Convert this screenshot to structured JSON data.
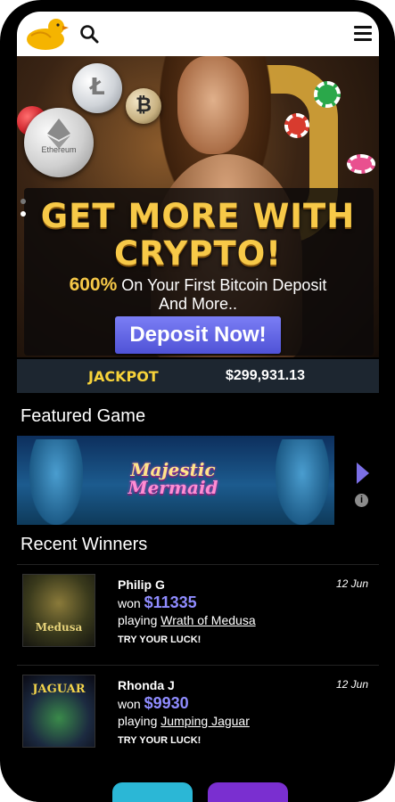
{
  "header": {
    "logo_icon": "duck-logo-icon",
    "search_icon": "search-icon",
    "menu_icon": "hamburger-menu-icon"
  },
  "hero": {
    "coin_label": "Ethereum",
    "headline_line1": "GET MORE WITH",
    "headline_line2": "CRYPTO!",
    "percent": "600%",
    "subline_rest": " On Your First Bitcoin Deposit",
    "subline2": "And More..",
    "cta_label": "Deposit Now!"
  },
  "jackpot": {
    "label": "JACKPOT",
    "value": "$299,931.13"
  },
  "featured": {
    "title": "Featured Game",
    "game_line1": "Majestic",
    "game_line2": "Mermaid"
  },
  "recent": {
    "title": "Recent Winners",
    "winners": [
      {
        "name": "Philip G",
        "date": "12 Jun",
        "won_prefix": "won ",
        "amount": "$11335",
        "playing_prefix": "playing ",
        "game": "Wrath of Medusa",
        "thumb_text": "Medusa",
        "cta": "TRY YOUR LUCK!"
      },
      {
        "name": "Rhonda J",
        "date": "12 Jun",
        "won_prefix": "won ",
        "amount": "$9930",
        "playing_prefix": "playing ",
        "game": "Jumping Jaguar",
        "thumb_text": "JAGUAR",
        "cta": "TRY YOUR LUCK!"
      }
    ]
  },
  "colors": {
    "accent_gold": "#f7c948",
    "accent_purple": "#7b7ef5",
    "jackpot_bg": "#1d2630"
  }
}
